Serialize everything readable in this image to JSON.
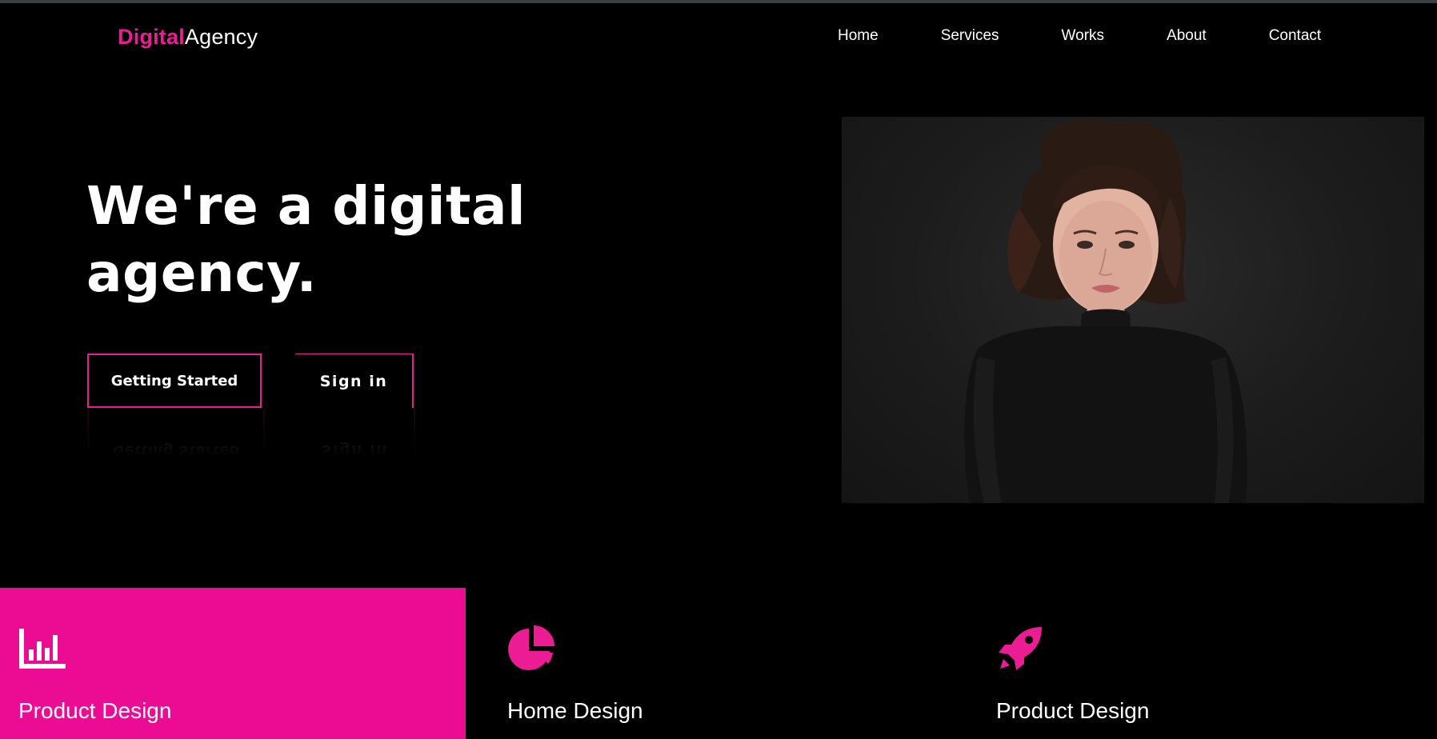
{
  "logo": {
    "accent": "Digital",
    "rest": "Agency"
  },
  "nav": [
    "Home",
    "Services",
    "Works",
    "About",
    "Contact"
  ],
  "hero": {
    "title": "We're a digital agency.",
    "primary_button": "Getting Started",
    "secondary_button": "Sign in"
  },
  "services": [
    {
      "title": "Product Design",
      "icon": "bar-chart-icon",
      "highlighted": true
    },
    {
      "title": "Home Design",
      "icon": "pie-chart-icon",
      "highlighted": false
    },
    {
      "title": "Product Design",
      "icon": "rocket-icon",
      "highlighted": false
    }
  ],
  "colors": {
    "accent": "#ec1c95",
    "card_highlight": "#ec0c94",
    "background": "#000000",
    "text": "#ffffff"
  }
}
